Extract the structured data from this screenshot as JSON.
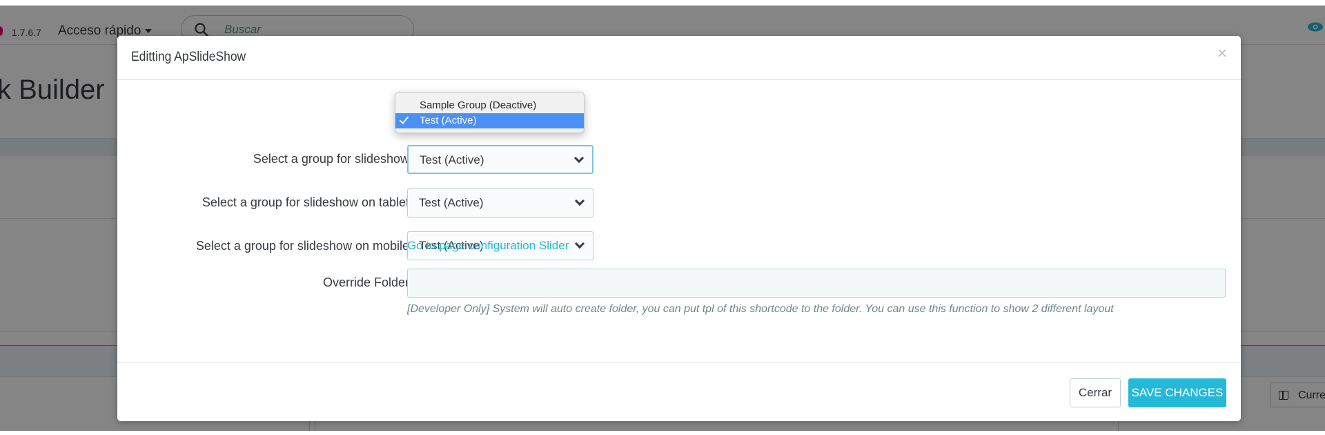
{
  "background": {
    "version": "1.7.6.7",
    "quick_access": "Acceso rápido",
    "search_placeholder": "Buscar",
    "page_title": "k Builder",
    "current_button": "Curren"
  },
  "modal": {
    "title": "Editting ApSlideShow",
    "close": "×",
    "fields": {
      "desktop_label": "Select a group for slideshow",
      "desktop_value": "Test (Active)",
      "tablet_label": "Select a group for slideshow on tablet",
      "tablet_value": "Test (Active)",
      "mobile_label": "Select a group for slideshow on mobile",
      "mobile_value": "Test (Active)",
      "config_link": "Go to page configuration Slider",
      "override_label": "Override Folder",
      "override_value": "",
      "help_text": "[Developer Only] System will auto create folder, you can put tpl of this shortcode to the folder. You can use this function to show 2 different layout"
    },
    "footer": {
      "close_label": "Cerrar",
      "save_label": "SAVE CHANGES"
    }
  },
  "dropdown": {
    "options": [
      {
        "label": "Sample Group (Deactive)",
        "selected": false
      },
      {
        "label": "Test (Active)",
        "selected": true
      }
    ]
  },
  "colors": {
    "accent": "#25b9d7",
    "selection": "#4a90f5",
    "brand": "#df0067"
  }
}
